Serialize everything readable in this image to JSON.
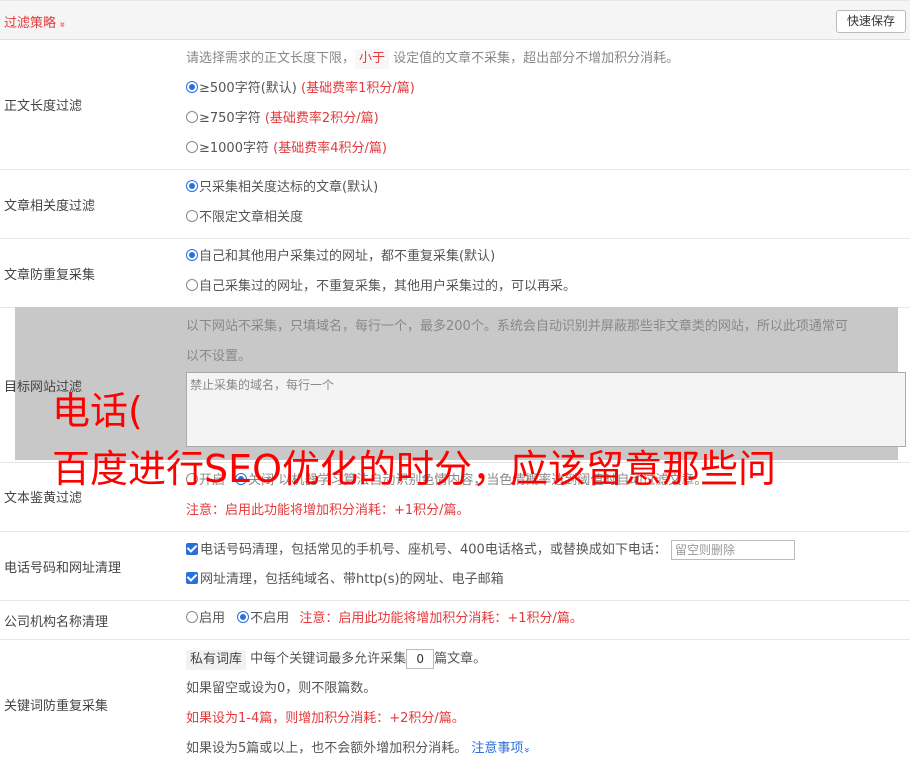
{
  "header": {
    "title": "过滤策略",
    "chevron": "»",
    "save_label": "快速保存"
  },
  "length_filter": {
    "label": "正文长度过滤",
    "desc_before": "请选择需求的正文长度下限，",
    "desc_tag": "小于",
    "desc_after": "设定值的文章不采集，超出部分不增加积分消耗。",
    "options": [
      {
        "text": "≥500字符(默认)",
        "note": "(基础费率1积分/篇)",
        "checked": true
      },
      {
        "text": "≥750字符",
        "note": "(基础费率2积分/篇)",
        "checked": false
      },
      {
        "text": "≥1000字符",
        "note": "(基础费率4积分/篇)",
        "checked": false
      }
    ]
  },
  "relevance_filter": {
    "label": "文章相关度过滤",
    "options": [
      {
        "text": "只采集相关度达标的文章(默认)",
        "checked": true
      },
      {
        "text": "不限定文章相关度",
        "checked": false
      }
    ]
  },
  "duplicate_filter": {
    "label": "文章防重复采集",
    "options": [
      {
        "text": "自己和其他用户采集过的网址，都不重复采集(默认)",
        "checked": true
      },
      {
        "text": "自己采集过的网址，不重复采集，其他用户采集过的，可以再采。",
        "checked": false
      }
    ]
  },
  "site_filter": {
    "label": "目标网站过滤",
    "desc_line1": "以下网站不采集，只填域名，每行一个，最多200个。系统会自动识别并屏蔽那些非文章类的网站，所以此项通常可",
    "desc_line2": "以不设置。",
    "placeholder": "禁止采集的域名，每行一个"
  },
  "porn_filter": {
    "label": "文本鉴黄过滤",
    "opt_on": "开启",
    "opt_off": "关闭",
    "desc": "以机器学习算法自动识别色情内容，当色情概率达到阈值时自动过滤文章。",
    "note": "注意：启用此功能将增加积分消耗：+1积分/篇。"
  },
  "phone_clean": {
    "label": "电话号码和网址清理",
    "phone_text": "电话号码清理，包括常见的手机号、座机号、400电话格式，或替换成如下电话：",
    "phone_placeholder": "留空则删除",
    "url_text": "网址清理，包括纯域名、带http(s)的网址、电子邮箱"
  },
  "company_clean": {
    "label": "公司机构名称清理",
    "opt_on": "启用",
    "opt_off": "不启用",
    "note": "注意：启用此功能将增加积分消耗：+1积分/篇。"
  },
  "keyword_dup": {
    "label": "关键词防重复采集",
    "tag": "私有词库",
    "line1_before": "中每个关键词最多允许采集",
    "value": "0",
    "line1_after": "篇文章。",
    "line2": "如果留空或设为0，则不限篇数。",
    "line3": "如果设为1-4篇，则增加积分消耗：+2积分/篇。",
    "line4": "如果设为5篇或以上，也不会额外增加积分消耗。",
    "link": "注意事项",
    "link_chevron": "»"
  },
  "overlay": {
    "line1": "电话(",
    "line2": "百度进行SEO优化的时分，应该留意那些问"
  },
  "colors": {
    "accent_red": "#e4393c",
    "radio_blue": "#2a6fdb",
    "overlay_red": "#ff0000",
    "gray_box": "#c8c8c8"
  }
}
